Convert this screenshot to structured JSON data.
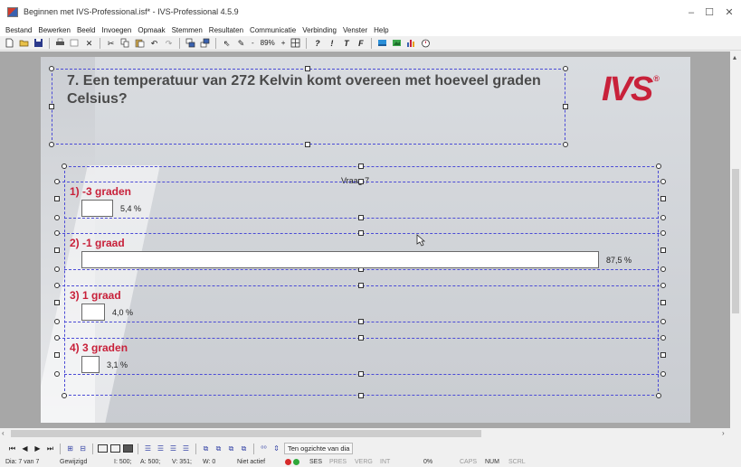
{
  "window": {
    "title": "Beginnen met IVS-Professional.isf* - IVS-Professional 4.5.9",
    "minimize": "–",
    "maximize": "☐",
    "close": "✕"
  },
  "menu": [
    "Bestand",
    "Bewerken",
    "Beeld",
    "Invoegen",
    "Opmaak",
    "Stemmen",
    "Resultaten",
    "Communicatie",
    "Verbinding",
    "Venster",
    "Help"
  ],
  "toolbar": {
    "zoom_minus": "-",
    "zoom": "89%",
    "zoom_plus": "+",
    "text_tools": [
      "?",
      "!",
      "T",
      "F"
    ]
  },
  "slide": {
    "question": "7. Een temperatuur van 272 Kelvin komt overeen met hoeveel graden Celsius?",
    "logo": "IVS",
    "logo_mark": "®",
    "chart_title": "Vraag 7"
  },
  "chart_data": {
    "type": "bar",
    "title": "Vraag 7",
    "categories": [
      "1) -3 graden",
      "2) -1 graad",
      "3) 1 graad",
      "4) 3 graden"
    ],
    "values": [
      5.4,
      87.5,
      4.0,
      3.1
    ],
    "value_labels": [
      "5,4 %",
      "87,5 %",
      "4,0 %",
      "3,1 %"
    ],
    "unit": "%",
    "orientation": "horizontal",
    "xlim": [
      0,
      100
    ]
  },
  "bottom_strip": {
    "view_label": "Ten ogzichte van dia"
  },
  "status": {
    "slide": "Dia: 7 van 7",
    "state": "Gewijzigd",
    "i": "I: 500;",
    "a": "A: 500;",
    "v": "V: 351;",
    "w": "W: 0",
    "active": "Niet actief",
    "ses": "SES",
    "pres": "PRES",
    "verg": "VERG",
    "int": "INT",
    "pct": "0%",
    "caps": "CAPS",
    "num": "NUM",
    "scrl": "SCRL"
  },
  "colors": {
    "accent_red": "#c8213a",
    "selection_blue": "#4b4bd6",
    "status_red": "#d62b2b",
    "status_green": "#2fa83a"
  }
}
